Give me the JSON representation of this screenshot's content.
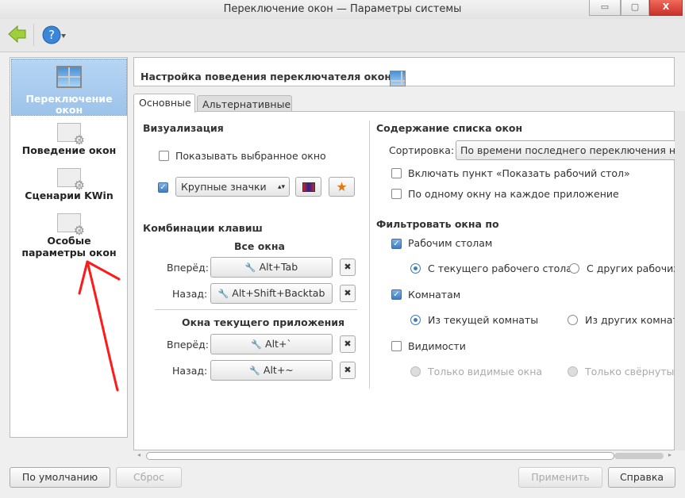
{
  "window": {
    "title": "Переключение окон — Параметры системы",
    "minimize": "▭",
    "maximize": "▢",
    "close": "X"
  },
  "toolbar": {
    "back_icon": "back-arrow-icon",
    "help_icon": "help-icon"
  },
  "sidebar": {
    "items": [
      {
        "label": "Переключение окон",
        "selected": true
      },
      {
        "label": "Поведение окон"
      },
      {
        "label": "Сценарии KWin"
      },
      {
        "label": "Особые параметры окон"
      }
    ]
  },
  "header": {
    "title": "Настройка поведения переключателя окон"
  },
  "tabs": [
    {
      "label": "Основные",
      "active": true
    },
    {
      "label": "Альтернативные"
    }
  ],
  "visualization": {
    "title": "Визуализация",
    "show_selected": "Показывать выбранное окно",
    "layout_value": "Крупные значки",
    "layout_arrows": "▴▾"
  },
  "shortcuts": {
    "title": "Комбинации клавиш",
    "all_windows": "Все окна",
    "current_app": "Окна текущего приложения",
    "forward": "Вперёд:",
    "back": "Назад:",
    "all_forward": "Alt+Tab",
    "all_back": "Alt+Shift+Backtab",
    "app_forward": "Alt+`",
    "app_back": "Alt+~",
    "clear": "✖",
    "wrench": "🔧"
  },
  "content": {
    "title": "Содержание списка окон",
    "sort_label": "Сортировка:",
    "sort_value": "По времени последнего переключения на окно",
    "show_desktop": "Включать пункт «Показать рабочий стол»",
    "one_per_app": "По одному окну на каждое приложение"
  },
  "filter": {
    "title": "Фильтровать окна по",
    "desktops": "Рабочим столам",
    "desktops_checked": true,
    "current_desktop": "С текущего рабочего стола",
    "other_desktops": "С других рабочих столов",
    "activities": "Комнатам",
    "activities_checked": true,
    "current_activity": "Из текущей комнаты",
    "other_activities": "Из других комнат",
    "visibility": "Видимости",
    "visibility_checked": false,
    "only_visible": "Только видимые окна",
    "only_minimized": "Только свёрнутые окна"
  },
  "buttons": {
    "defaults": "По умолчанию",
    "reset": "Сброс",
    "apply": "Применить",
    "help": "Справка"
  },
  "annotation_color": "#ff1a1a"
}
